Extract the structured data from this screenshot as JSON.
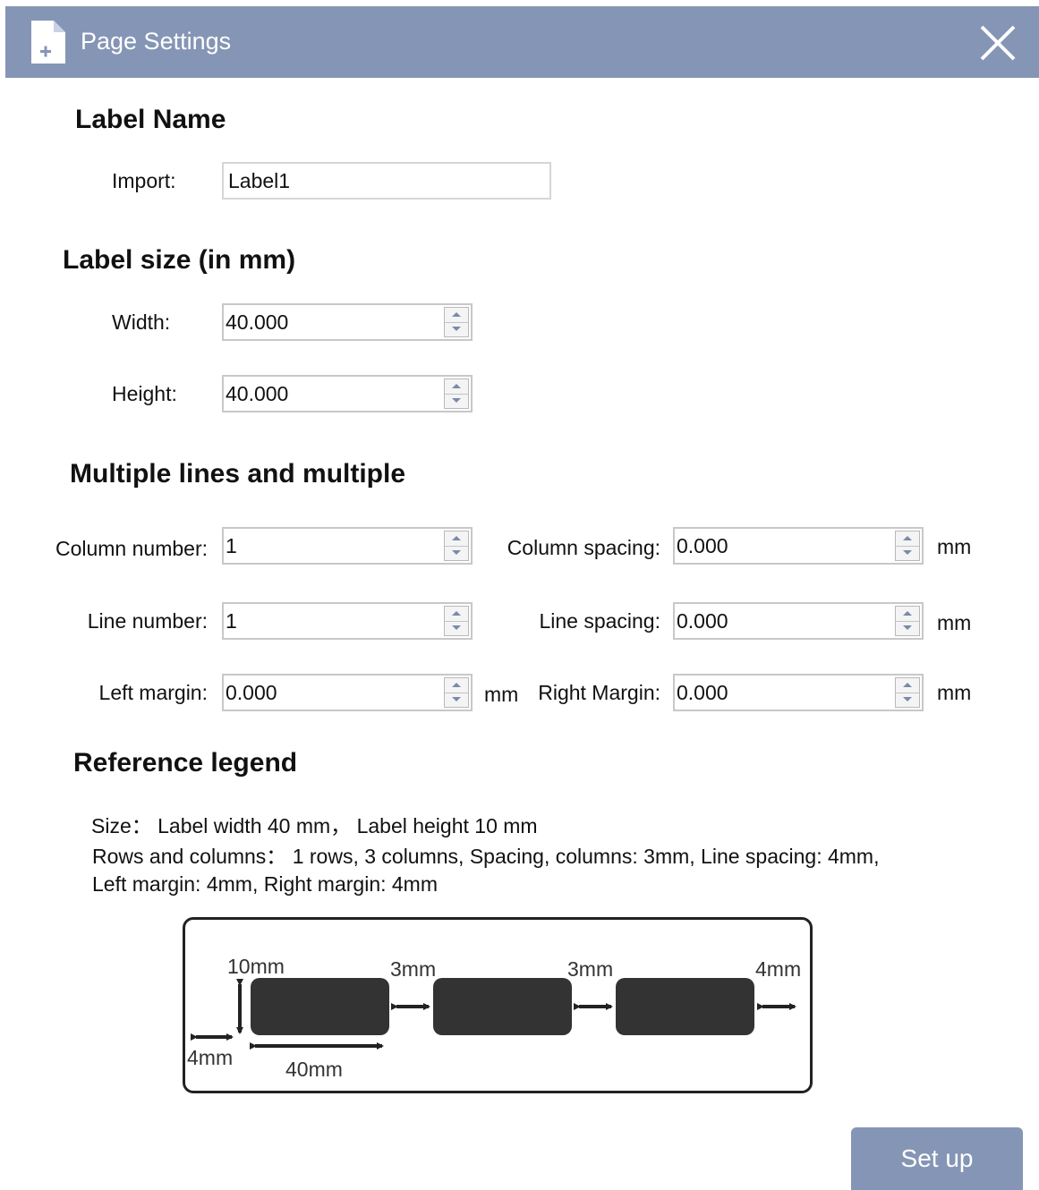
{
  "titlebar": {
    "title": "Page Settings",
    "icon": "document-add-icon",
    "close_icon": "close-icon",
    "background": "#8595b5"
  },
  "label_name": {
    "heading": "Label Name",
    "import_label": "Import:",
    "import_value": "Label1"
  },
  "label_size": {
    "heading": "Label size (in mm)",
    "width_label": "Width:",
    "width_value": "40.000",
    "height_label": "Height:",
    "height_value": "40.000"
  },
  "multiple": {
    "heading": "Multiple lines and multiple",
    "column_number_label": "Column number:",
    "column_number_value": "1",
    "column_spacing_label": "Column spacing:",
    "column_spacing_value": "0.000",
    "line_number_label": "Line number:",
    "line_number_value": "1",
    "line_spacing_label": "Line spacing:",
    "line_spacing_value": "0.000",
    "left_margin_label": "Left margin:",
    "left_margin_value": "0.000",
    "right_margin_label": "Right Margin:",
    "right_margin_value": "0.000",
    "unit": "mm"
  },
  "legend": {
    "heading": "Reference legend",
    "size_line": "Size：  Label width 40 mm，  Label height 10 mm",
    "rows_line": "Rows and columns：  1 rows, 3 columns, Spacing, columns: 3mm, Line spacing: 4mm,",
    "margin_line": "Left margin: 4mm, Right margin: 4mm",
    "diagram": {
      "height_label": "10mm",
      "gap1_label": "3mm",
      "gap2_label": "3mm",
      "right_label": "4mm",
      "left_label": "4mm",
      "width_label": "40mm"
    }
  },
  "footer": {
    "setup_label": "Set up"
  }
}
